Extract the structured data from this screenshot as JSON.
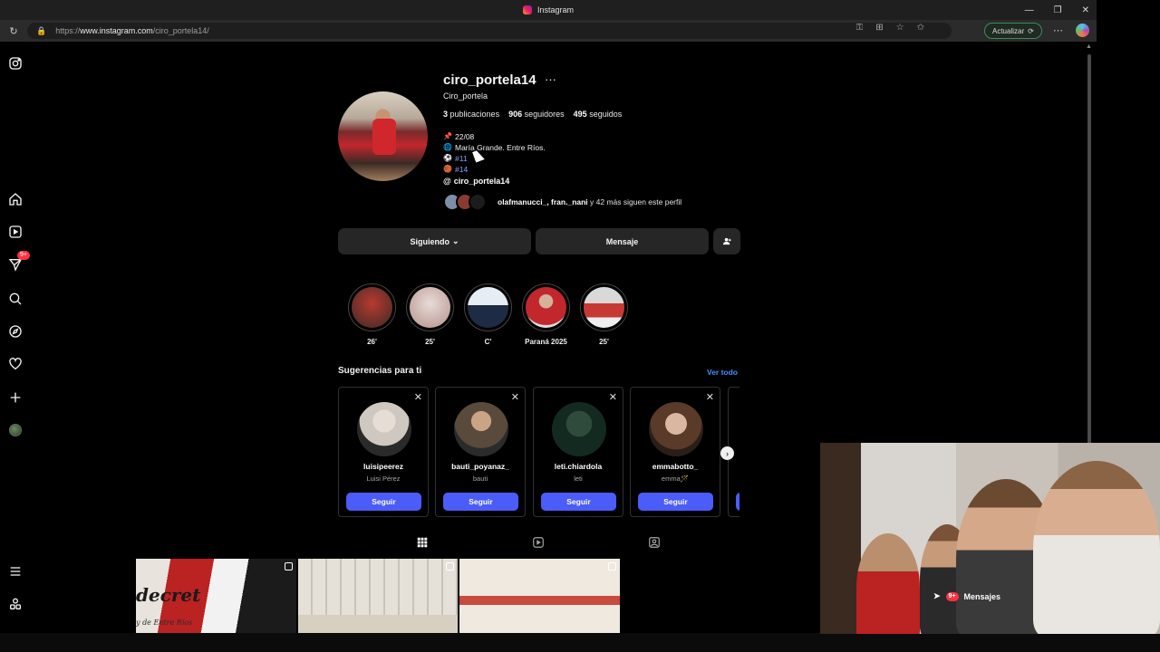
{
  "browser": {
    "tab_title": "Instagram",
    "url_prefix": "https://",
    "url_host": "www.instagram.com",
    "url_path": "/ciro_portela14/",
    "update_label": "Actualizar"
  },
  "profile": {
    "username": "ciro_portela14",
    "full_name": "Ciro_portela",
    "posts_count": "3",
    "posts_label": "publicaciones",
    "followers_count": "906",
    "followers_label": "seguidores",
    "following_count": "495",
    "following_label": "seguidos",
    "bio": [
      {
        "emoji": "📌",
        "text": "22/08"
      },
      {
        "emoji": "🌐",
        "text": "María Grande. Entre Ríos."
      },
      {
        "emoji": "⚽",
        "text": "#11"
      },
      {
        "emoji": "🏀",
        "text": "#14"
      }
    ],
    "threads_handle": "ciro_portela14",
    "followed_by_names": "olafmanucci_, fran._nani",
    "followed_by_suffix": "y 42 más siguen este perfil",
    "following_button": "Siguiendo",
    "message_button": "Mensaje"
  },
  "highlights": [
    {
      "label": "26'",
      "color": "#8b2b25"
    },
    {
      "label": "25'",
      "color": "#c8a9a6"
    },
    {
      "label": "C'",
      "color": "#a9b9cc"
    },
    {
      "label": "Paraná 2025",
      "color": "#b8322c"
    },
    {
      "label": "25'",
      "color": "#b94640"
    }
  ],
  "suggestions": {
    "title": "Sugerencias para ti",
    "see_all": "Ver todo",
    "follow_label": "Seguir",
    "items": [
      {
        "username": "luisipeerez",
        "name": "Luisi Pérez",
        "color": "#cfc8c0"
      },
      {
        "username": "bauti_poyanaz_",
        "name": "bauti",
        "color": "#5a4a3c"
      },
      {
        "username": "leti.chiardola",
        "name": "leti",
        "color": "#1f3a2e"
      },
      {
        "username": "emmabotto_",
        "name": "emma🪄",
        "color": "#8a6a55"
      }
    ]
  },
  "posts": {
    "post1_banner": "decret",
    "post1_subbanner": "y de Entre Ríos"
  },
  "nav": {
    "notifications_badge": "9+"
  },
  "overlay": {
    "messages_label": "Mensajes",
    "messages_badge": "9+"
  }
}
